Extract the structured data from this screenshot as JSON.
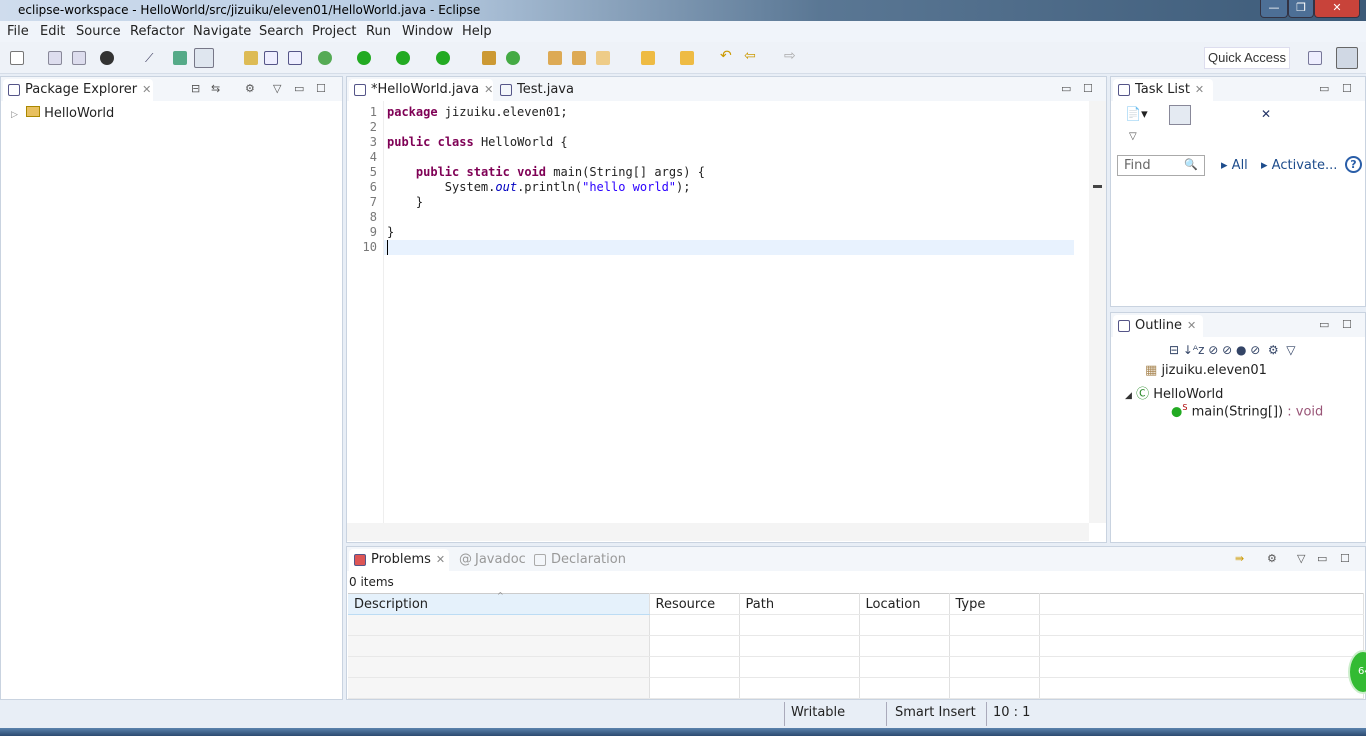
{
  "window": {
    "title": "eclipse-workspace - HelloWorld/src/jizuiku/eleven01/HelloWorld.java - Eclipse"
  },
  "menu": [
    "File",
    "Edit",
    "Source",
    "Refactor",
    "Navigate",
    "Search",
    "Project",
    "Run",
    "Window",
    "Help"
  ],
  "toolbar": {
    "quick_access": "Quick Access"
  },
  "package_explorer": {
    "title": "Package Explorer",
    "items": [
      {
        "label": "HelloWorld"
      }
    ]
  },
  "editor": {
    "tabs": [
      {
        "label": "*HelloWorld.java",
        "active": true
      },
      {
        "label": "Test.java",
        "active": false
      }
    ],
    "lines": [
      [
        {
          "t": "package",
          "c": "kw"
        },
        {
          "t": " jizuiku.eleven01;"
        }
      ],
      [],
      [
        {
          "t": "public",
          "c": "kw"
        },
        {
          "t": " "
        },
        {
          "t": "class",
          "c": "kw"
        },
        {
          "t": " HelloWorld {"
        }
      ],
      [],
      [
        {
          "t": "    "
        },
        {
          "t": "public",
          "c": "kw"
        },
        {
          "t": " "
        },
        {
          "t": "static",
          "c": "kw"
        },
        {
          "t": " "
        },
        {
          "t": "void",
          "c": "kw"
        },
        {
          "t": " main(String[] args) {"
        }
      ],
      [
        {
          "t": "        System."
        },
        {
          "t": "out",
          "c": "fld"
        },
        {
          "t": ".println("
        },
        {
          "t": "\"hello world\"",
          "c": "str"
        },
        {
          "t": ");"
        }
      ],
      [
        {
          "t": "    }"
        }
      ],
      [],
      [
        {
          "t": "}"
        }
      ],
      []
    ],
    "current_line": 10
  },
  "task_list": {
    "title": "Task List",
    "find_placeholder": "Find",
    "all": "All",
    "activate": "Activate..."
  },
  "outline": {
    "title": "Outline",
    "package": "jizuiku.eleven01",
    "class": "HelloWorld",
    "method": "main(String[])",
    "method_type": " : void"
  },
  "problems": {
    "tabs": [
      "Problems",
      "Javadoc",
      "Declaration"
    ],
    "count": "0 items",
    "columns": [
      "Description",
      "Resource",
      "Path",
      "Location",
      "Type"
    ]
  },
  "status": {
    "writable": "Writable",
    "insert": "Smart Insert",
    "position": "10 : 1"
  }
}
